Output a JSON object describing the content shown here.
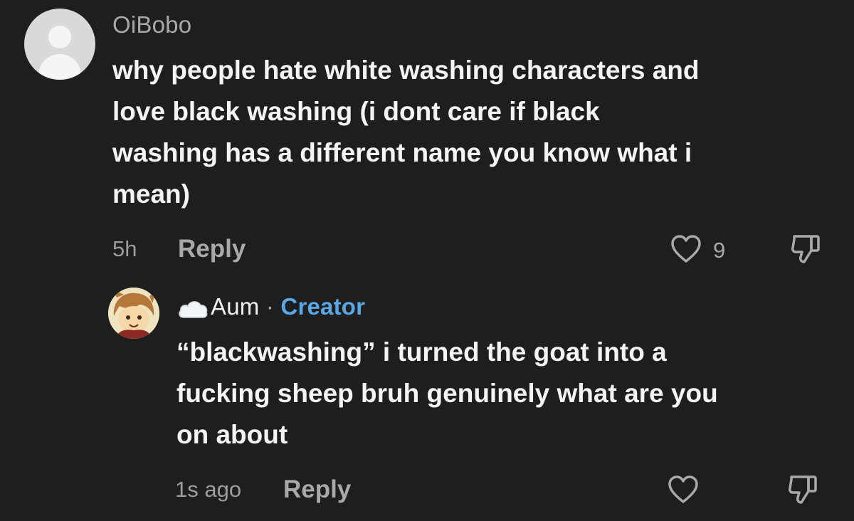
{
  "comments": [
    {
      "username": "OiBobo",
      "text_lines": [
        "why people hate white washing characters and",
        "love black washing (i dont care if black",
        "washing has a different name you know what i",
        "mean)"
      ],
      "time": "5h",
      "reply_label": "Reply",
      "like_count": "9",
      "avatar_icon": "default-user-avatar",
      "like_icon": "heart-icon",
      "dislike_icon": "thumbs-down-icon"
    },
    {
      "username": "Aum",
      "separator": "·",
      "badge": "Creator",
      "name_emoji": "cloud",
      "text_lines": [
        "“blackwashing” i turned the goat into a",
        "fucking sheep bruh genuinely what are you",
        "on about"
      ],
      "time": "1s ago",
      "reply_label": "Reply",
      "avatar_icon": "illustrated-character-avatar",
      "like_icon": "heart-icon",
      "dislike_icon": "thumbs-down-icon"
    }
  ],
  "colors": {
    "background": "#1e1e1e",
    "text_primary": "#f4f4f4",
    "text_secondary": "#a9a9a9",
    "creator_badge": "#5aa7e6"
  }
}
